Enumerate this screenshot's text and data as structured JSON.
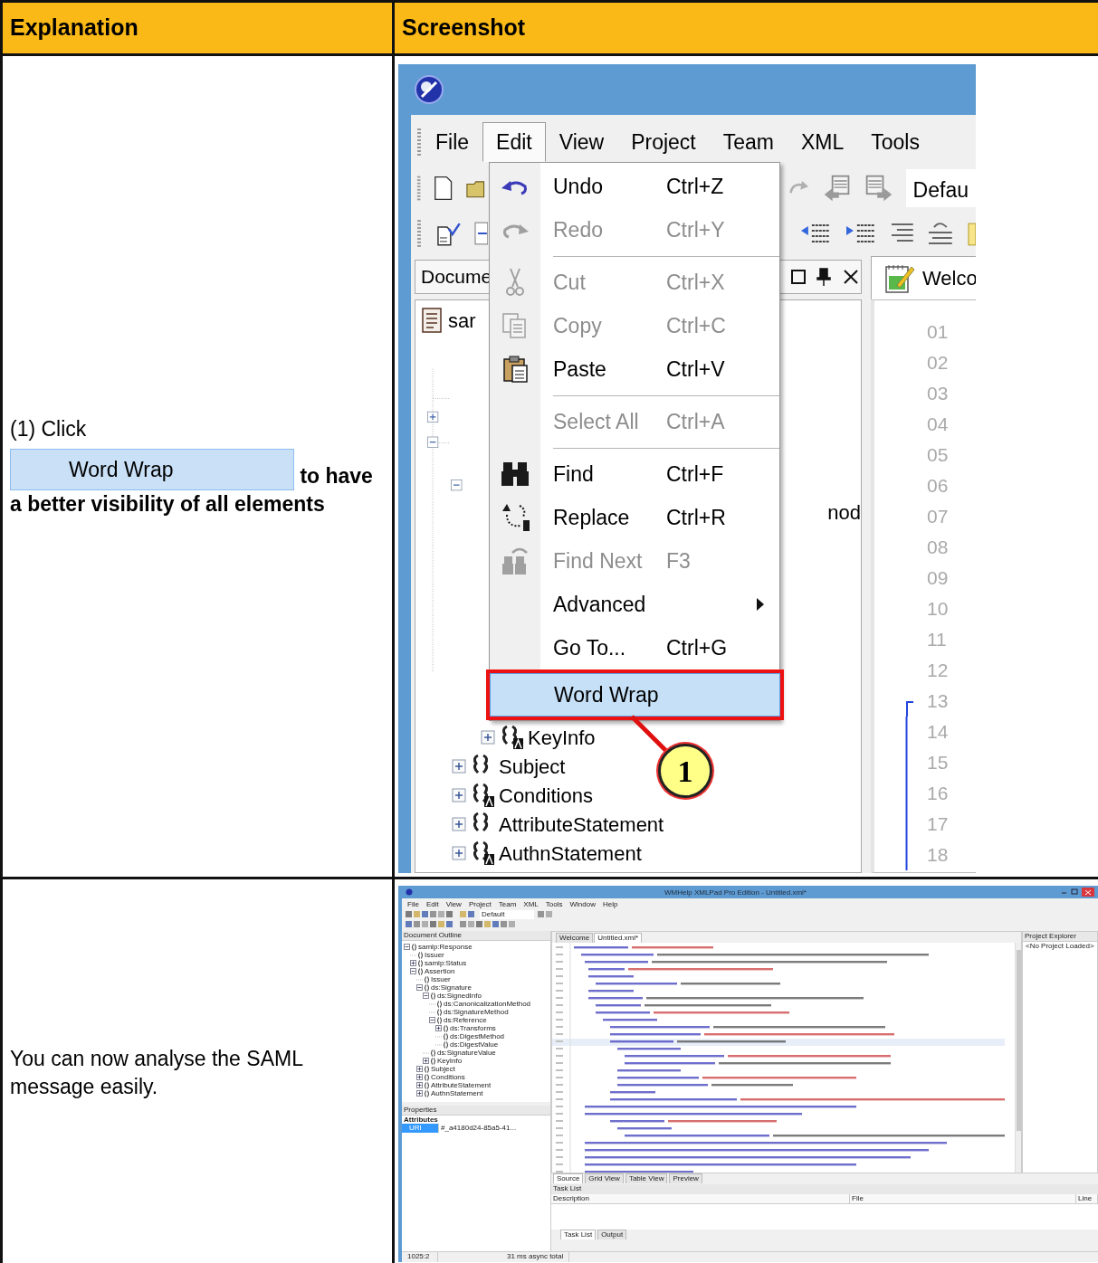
{
  "table": {
    "columns": [
      {
        "label": "Explanation"
      },
      {
        "label": "Screenshot"
      }
    ]
  },
  "step_1": {
    "explanation": {
      "lead": "(1) Click",
      "menu_item": "Word Wrap",
      "trail": "to have a better visibility of all elements"
    },
    "screenshot": {
      "menu_bar": [
        {
          "label": "File",
          "selected": false
        },
        {
          "label": "Edit",
          "selected": true
        },
        {
          "label": "View",
          "selected": false
        },
        {
          "label": "Project",
          "selected": false
        },
        {
          "label": "Team",
          "selected": false
        },
        {
          "label": "XML",
          "selected": false
        },
        {
          "label": "Tools",
          "selected": false
        }
      ],
      "toolbar_dropdown": "Defau",
      "outline_panel": {
        "title": "Docume",
        "root": "sar",
        "covered_fragment": "nod",
        "inner_rows": [
          {
            "label": "KeyInfo",
            "expanded": false,
            "attributes": true
          }
        ],
        "outer_rows": [
          {
            "label": "Subject",
            "expanded": false,
            "attributes": false
          },
          {
            "label": "Conditions",
            "expanded": false,
            "attributes": true
          },
          {
            "label": "AttributeStatement",
            "expanded": false,
            "attributes": false
          },
          {
            "label": "AuthnStatement",
            "expanded": false,
            "attributes": true
          }
        ]
      },
      "editor": {
        "tab": "Welco",
        "line_numbers": [
          {
            "number": "01"
          },
          {
            "number": "02"
          },
          {
            "number": "03"
          },
          {
            "number": "04"
          },
          {
            "number": "05"
          },
          {
            "number": "06"
          },
          {
            "number": "07"
          },
          {
            "number": "08"
          },
          {
            "number": "09"
          },
          {
            "number": "10"
          },
          {
            "number": "11"
          },
          {
            "number": "12"
          },
          {
            "number": "13",
            "fold_start": true
          },
          {
            "number": "14",
            "in_fold": true
          },
          {
            "number": "15",
            "in_fold": true
          },
          {
            "number": "16",
            "in_fold": true
          },
          {
            "number": "17",
            "in_fold": true
          },
          {
            "number": "18",
            "in_fold": true
          }
        ]
      },
      "edit_menu": [
        {
          "kind": "item",
          "label": "Undo",
          "shortcut": "Ctrl+Z",
          "disabled": false,
          "selected": false
        },
        {
          "kind": "item",
          "label": "Redo",
          "shortcut": "Ctrl+Y",
          "disabled": true,
          "selected": false
        },
        {
          "kind": "separator"
        },
        {
          "kind": "item",
          "label": "Cut",
          "shortcut": "Ctrl+X",
          "disabled": true,
          "selected": false
        },
        {
          "kind": "item",
          "label": "Copy",
          "shortcut": "Ctrl+C",
          "disabled": true,
          "selected": false
        },
        {
          "kind": "item",
          "label": "Paste",
          "shortcut": "Ctrl+V",
          "disabled": false,
          "selected": false
        },
        {
          "kind": "separator"
        },
        {
          "kind": "item",
          "label": "Select All",
          "shortcut": "Ctrl+A",
          "disabled": true,
          "selected": false
        },
        {
          "kind": "separator"
        },
        {
          "kind": "item",
          "label": "Find",
          "shortcut": "Ctrl+F",
          "disabled": false,
          "selected": false
        },
        {
          "kind": "item",
          "label": "Replace",
          "shortcut": "Ctrl+R",
          "disabled": false,
          "selected": false
        },
        {
          "kind": "item",
          "label": "Find Next",
          "shortcut": "F3",
          "disabled": true,
          "selected": false
        },
        {
          "kind": "submenu",
          "label": "Advanced",
          "disabled": false,
          "selected": false
        },
        {
          "kind": "item",
          "label": "Go To...",
          "shortcut": "Ctrl+G",
          "disabled": false,
          "selected": false
        },
        {
          "kind": "item",
          "label": "Word Wrap",
          "disabled": false,
          "selected": true
        }
      ],
      "callout": {
        "number": "1"
      }
    }
  },
  "step_2": {
    "explanation": "You can now analyse the SAML message easily.",
    "screenshot": {
      "window_title": "WMHelp XMLPad Pro Edition - Untitled.xml*",
      "menu_bar": [
        "File",
        "Edit",
        "View",
        "Project",
        "Team",
        "XML",
        "Tools",
        "Window",
        "Help"
      ],
      "toolbar_dropdown": "Default",
      "outline_panel": {
        "title": "Document Outline",
        "tree": [
          {
            "label": "samlp:Response",
            "expanded": true,
            "children": [
              {
                "label": "Issuer"
              },
              {
                "label": "samlp:Status",
                "expanded": false
              },
              {
                "label": "Assertion",
                "expanded": true,
                "children": [
                  {
                    "label": "Issuer"
                  },
                  {
                    "label": "ds:Signature",
                    "expanded": true,
                    "children": [
                      {
                        "label": "ds:SignedInfo",
                        "expanded": true,
                        "children": [
                          {
                            "label": "ds:CanonicalizationMethod"
                          },
                          {
                            "label": "ds:SignatureMethod"
                          },
                          {
                            "label": "ds:Reference",
                            "expanded": true,
                            "children": [
                              {
                                "label": "ds:Transforms",
                                "expanded": false
                              },
                              {
                                "label": "ds:DigestMethod"
                              },
                              {
                                "label": "ds:DigestValue"
                              }
                            ]
                          }
                        ]
                      },
                      {
                        "label": "ds:SignatureValue"
                      },
                      {
                        "label": "KeyInfo",
                        "expanded": false
                      }
                    ]
                  },
                  {
                    "label": "Subject",
                    "expanded": false
                  },
                  {
                    "label": "Conditions",
                    "expanded": false
                  },
                  {
                    "label": "AttributeStatement",
                    "expanded": false
                  },
                  {
                    "label": "AuthnStatement",
                    "expanded": false
                  }
                ]
              }
            ]
          }
        ]
      },
      "properties_panel": {
        "title": "Properties",
        "group": "Attributes",
        "rows": [
          {
            "name": "URI",
            "value": "#_a4180d24-85a5-41...",
            "selected": true
          }
        ]
      },
      "editor_tabs": [
        {
          "label": "Welcome",
          "selected": false
        },
        {
          "label": "Untitled.xml*",
          "selected": true
        }
      ],
      "view_tabs": [
        {
          "label": "Source",
          "selected": true
        },
        {
          "label": "Grid View",
          "selected": false
        },
        {
          "label": "Table View",
          "selected": false
        },
        {
          "label": "Preview",
          "selected": false
        }
      ],
      "project_explorer": {
        "title": "Project Explorer",
        "message": "<No Project Loaded>"
      },
      "task_list": {
        "title": "Task List",
        "columns": [
          "Description",
          "File",
          "Line"
        ]
      },
      "bottom_tabs": [
        {
          "label": "Task List",
          "selected": true
        },
        {
          "label": "Output",
          "selected": false
        }
      ],
      "status_bar": [
        "1025:2",
        "31 ms async total"
      ]
    }
  }
}
